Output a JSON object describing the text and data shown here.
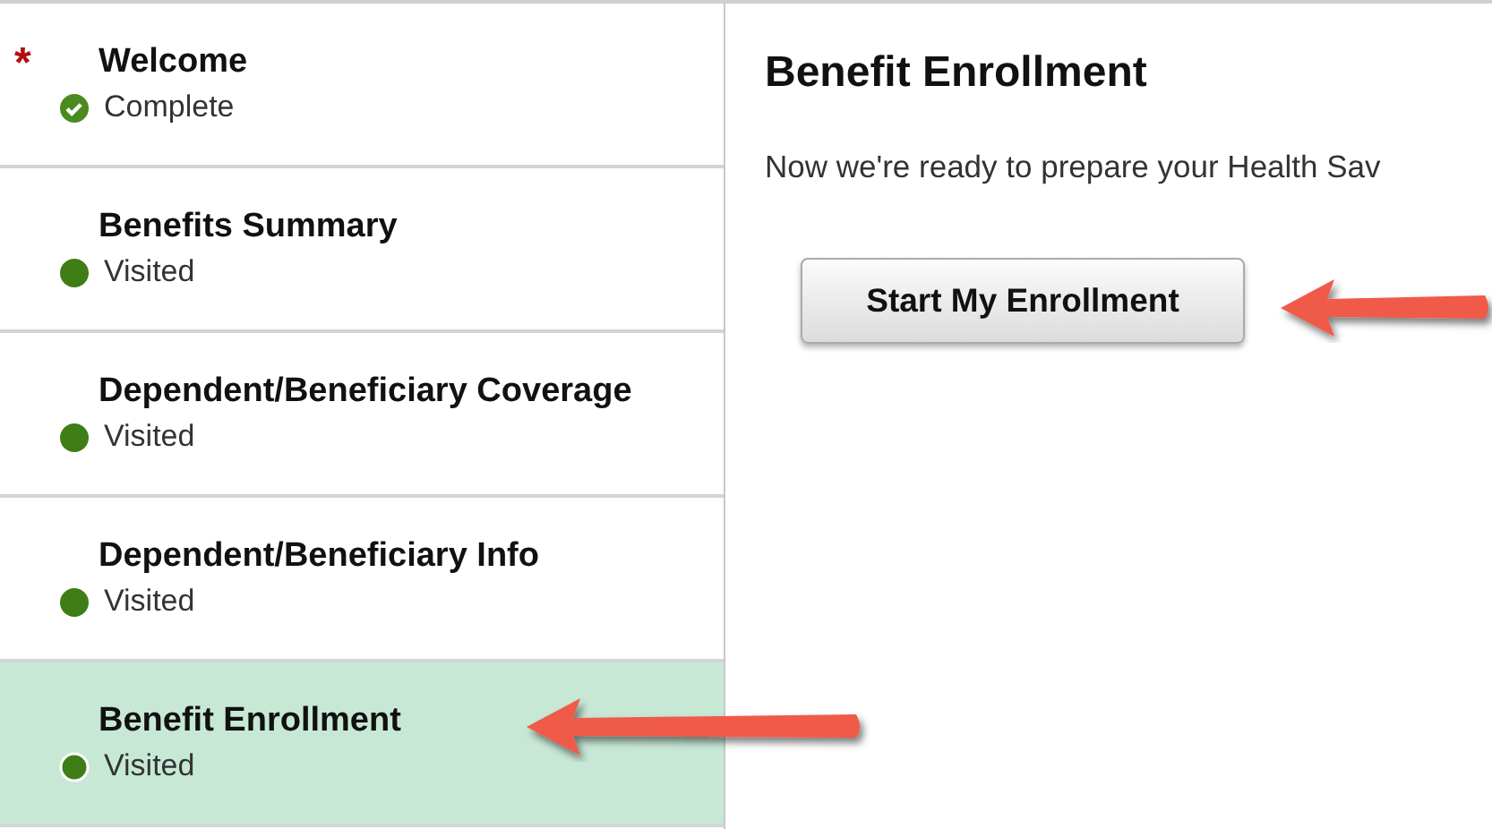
{
  "sidebar": {
    "items": [
      {
        "title": "Welcome",
        "status": "Complete",
        "kind": "complete",
        "required": true,
        "selected": false
      },
      {
        "title": "Benefits Summary",
        "status": "Visited",
        "kind": "visited",
        "required": false,
        "selected": false
      },
      {
        "title": "Dependent/Beneficiary Coverage",
        "status": "Visited",
        "kind": "visited",
        "required": false,
        "selected": false
      },
      {
        "title": "Dependent/Beneficiary Info",
        "status": "Visited",
        "kind": "visited",
        "required": false,
        "selected": false
      },
      {
        "title": "Benefit Enrollment",
        "status": "Visited",
        "kind": "visited",
        "required": false,
        "selected": true
      }
    ]
  },
  "main": {
    "title": "Benefit Enrollment",
    "text": "Now we're ready to prepare your Health Sav",
    "button": "Start My Enrollment"
  },
  "required_mark": "*"
}
